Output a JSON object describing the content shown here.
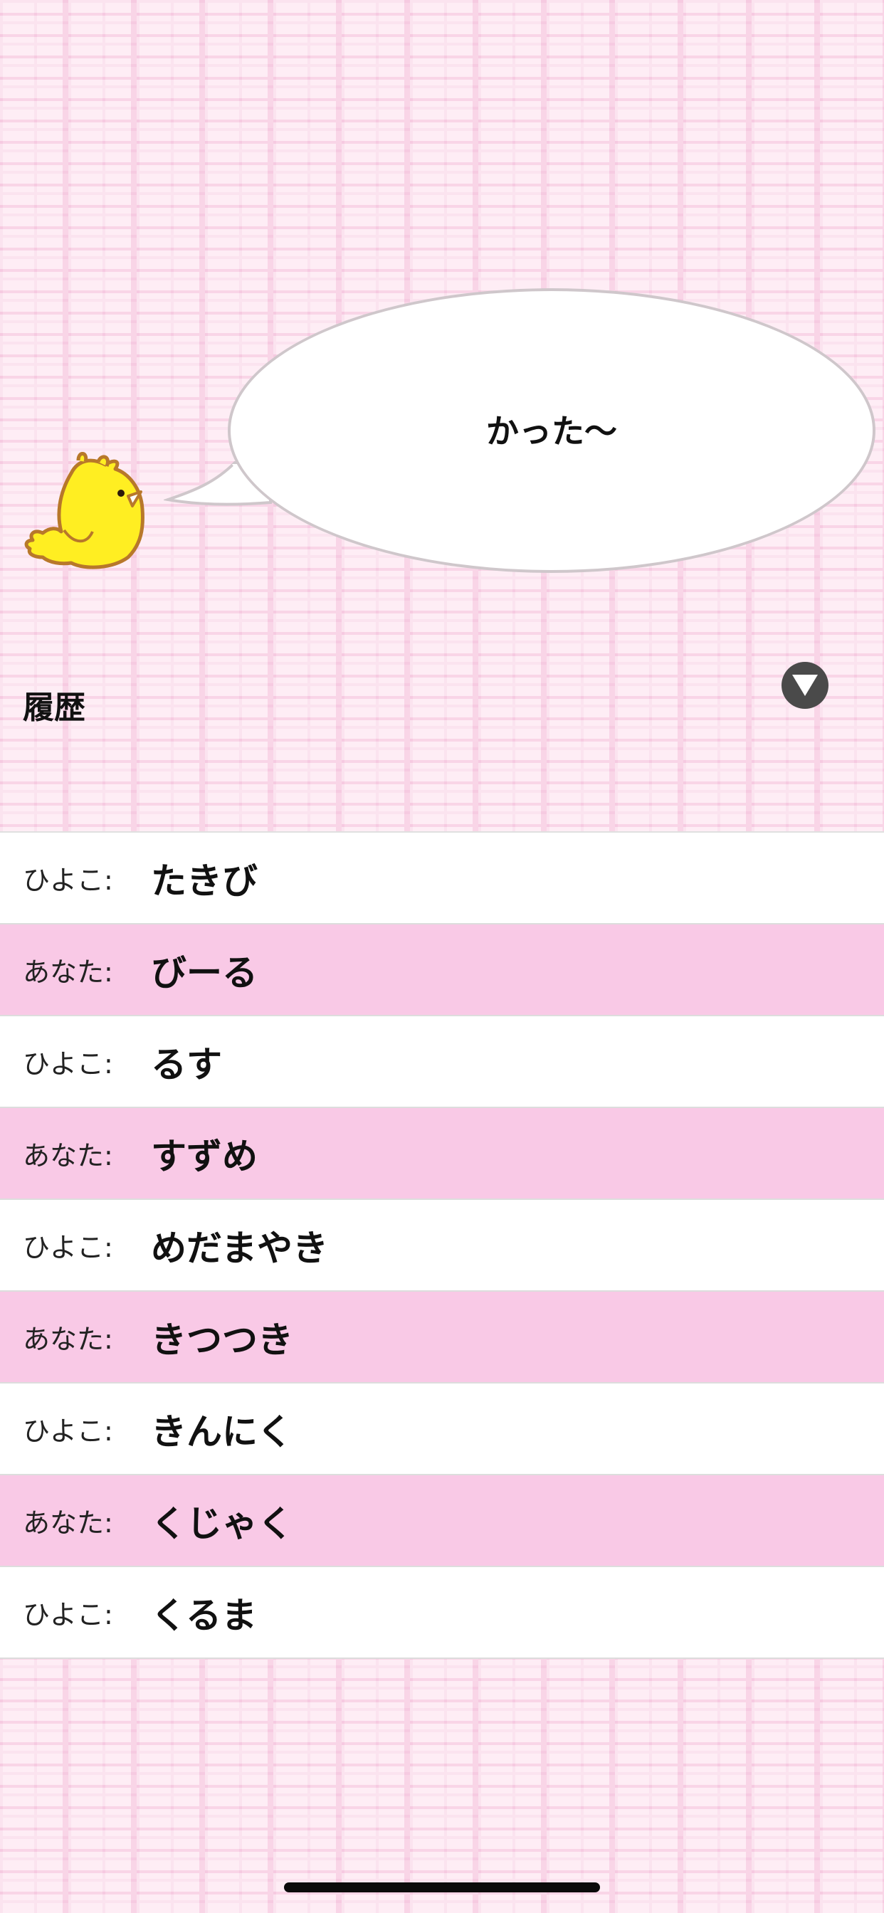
{
  "bubble": {
    "text": "かった〜"
  },
  "history": {
    "title": "履歴"
  },
  "icons": {
    "toggle": "triangle-down-icon",
    "mascot": "chick-icon"
  },
  "rows": [
    {
      "speaker": "ひよこ:",
      "word": "たきび",
      "type": "chick"
    },
    {
      "speaker": "あなた:",
      "word": "びーる",
      "type": "you"
    },
    {
      "speaker": "ひよこ:",
      "word": "るす",
      "type": "chick"
    },
    {
      "speaker": "あなた:",
      "word": "すずめ",
      "type": "you"
    },
    {
      "speaker": "ひよこ:",
      "word": "めだまやき",
      "type": "chick"
    },
    {
      "speaker": "あなた:",
      "word": "きつつき",
      "type": "you"
    },
    {
      "speaker": "ひよこ:",
      "word": "きんにく",
      "type": "chick"
    },
    {
      "speaker": "あなた:",
      "word": "くじゃく",
      "type": "you"
    },
    {
      "speaker": "ひよこ:",
      "word": "くるま",
      "type": "chick"
    }
  ],
  "colors": {
    "you_row": "#f9c9e6",
    "chick_row": "#ffffff",
    "toggle": "#4a4a4a"
  }
}
